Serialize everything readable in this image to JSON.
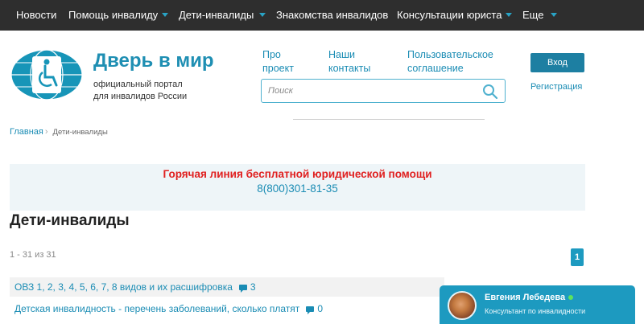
{
  "topnav": {
    "items": [
      {
        "label": "Новости",
        "has_dropdown": false
      },
      {
        "label": "Помощь инвалиду",
        "has_dropdown": true
      },
      {
        "label": "Дети-инвалиды",
        "has_dropdown": true
      },
      {
        "label": "Знакомства инвалидов",
        "has_dropdown": false
      },
      {
        "label": "Консультации юриста",
        "has_dropdown": true
      },
      {
        "label": "Еще",
        "has_dropdown": true
      }
    ]
  },
  "header": {
    "title": "Дверь в мир",
    "subtitle_line1": "официальный портал",
    "subtitle_line2": "для инвалидов России",
    "links": [
      {
        "line1": "Про",
        "line2": "проект"
      },
      {
        "line1": "Наши",
        "line2": "контакты"
      },
      {
        "line1": "Пользовательское",
        "line2": "соглашение"
      }
    ],
    "search_placeholder": "Поиск",
    "login_label": "Вход",
    "register_label": "Регистрация"
  },
  "breadcrumb": {
    "home": "Главная",
    "separator": "›",
    "current": "Дети-инвалиды"
  },
  "hotline": {
    "title": "Горячая линия бесплатной юридической помощи",
    "phone": "8(800)301-81-35"
  },
  "main": {
    "title": "Дети-инвалиды",
    "counter": "1 - 31 из 31",
    "page": "1",
    "articles": [
      {
        "title": "ОВЗ 1, 2, 3, 4, 5, 6, 7, 8 видов и их расшифровка",
        "comments": "3"
      },
      {
        "title": "Детская инвалидность - перечень заболеваний, сколько платят",
        "comments": "0"
      }
    ]
  },
  "chat": {
    "name": "Евгения Лебедева",
    "role": "Консультант по инвалидности",
    "status": "online"
  },
  "colors": {
    "topnav_bg": "#2e2e2e",
    "accent": "#1a8cb4",
    "hotline_title": "#e02020",
    "chat_bg": "#1d9ac0"
  }
}
